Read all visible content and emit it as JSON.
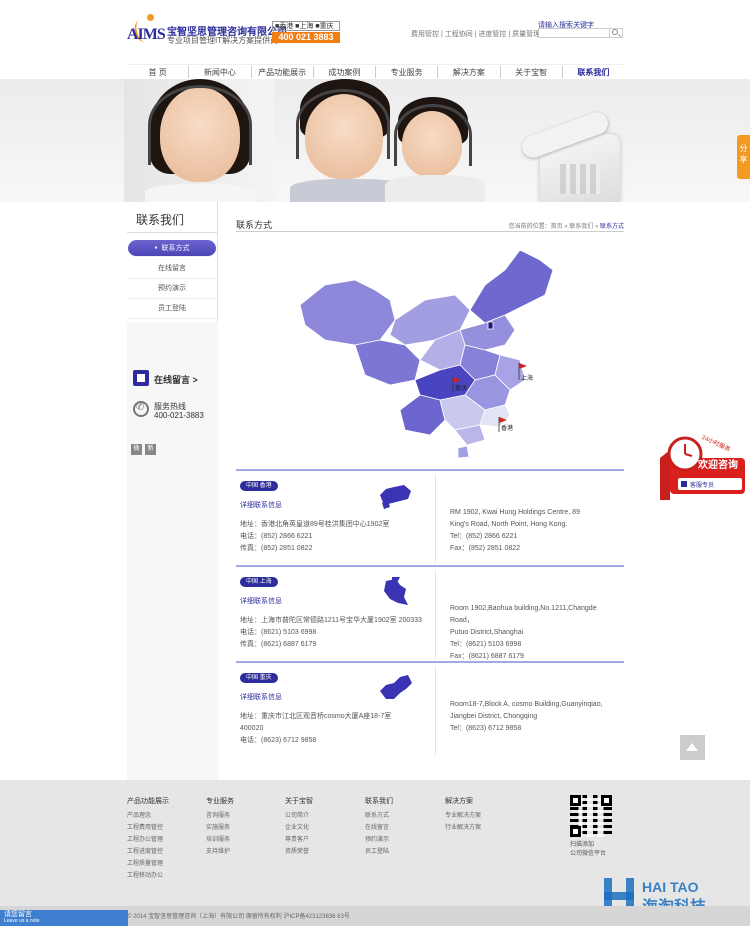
{
  "header": {
    "logo_text": "AIMS",
    "company_name": "宝智坚思管理咨询有限公司",
    "company_sub": "专业项目管理IT解决方案提供商",
    "cities": "■香港 ■上海 ■重庆",
    "hotline": "400 021 3883",
    "toplinks": "费用管控 | 工程协同 | 进度管控 | 质量管理",
    "search_label": "请输入搜索关键字",
    "search_placeholder": ""
  },
  "nav": [
    {
      "label": "首 页"
    },
    {
      "label": "新闻中心"
    },
    {
      "label": "产品功能展示"
    },
    {
      "label": "成功案例"
    },
    {
      "label": "专业服务"
    },
    {
      "label": "解决方案"
    },
    {
      "label": "关于宝智"
    },
    {
      "label": "联系我们"
    }
  ],
  "share_tab": "分享",
  "sidebar": {
    "title": "联系我们",
    "items": [
      {
        "label": "联系方式"
      },
      {
        "label": "在线留言"
      },
      {
        "label": "预约演示"
      },
      {
        "label": "员工登陆"
      }
    ],
    "message_label": "在线留言 >",
    "hotline_label": "服务热线",
    "hotline_number": "400-021-3883",
    "social": [
      "微",
      "新"
    ]
  },
  "main": {
    "title": "联系方式",
    "breadcrumb_prefix": "您当前的位置：首页 » 联系我们 » ",
    "breadcrumb_current": "联系方式"
  },
  "map_labels": {
    "shanghai": "上海",
    "chongqing": "重庆",
    "hongkong": "香港"
  },
  "offices": [
    {
      "tag": "中国 香港",
      "detail": "详细联系信息",
      "cn": [
        "地址：香港北角英皇道89号桂洪集团中心1902室",
        "电话：(852) 2866 6221",
        "传真：(852) 2851 0822"
      ],
      "en": [
        "RM 1902, Kwai Hung Holdings Centre, 89",
        "King's Road, North Point, Hong Kong.",
        "Tel：(852) 2866 6221",
        "Fax：(852) 2851 0822"
      ]
    },
    {
      "tag": "中国 上海",
      "detail": "详细联系信息",
      "cn": [
        "地址：上海市普陀区常德路1211号宝华大厦1902室 200333",
        "电话：(8621) 5103 6998",
        "传真：(8621) 6887 6179"
      ],
      "en": [
        "Room 1902,Baohua building,No.1211,Changde Road，",
        "Putuo District,Shanghai",
        "Tel：(8621) 5103 6998",
        "Fax：(8621) 6887 6179"
      ]
    },
    {
      "tag": "中国 重庆",
      "detail": "详细联系信息",
      "cn": [
        "地址：重庆市江北区观音桥cosmo大厦A座18-7室",
        "400020",
        "电话：(8623) 6712 9858"
      ],
      "en": [
        "Room18-7,Block A, cosmo Building,Guanyinqiao,",
        "Jiangbei District, Chongqing",
        "Tel：(8623) 6712 9858"
      ]
    }
  ],
  "consult": {
    "badge": "24小时服务",
    "title": "欢迎咨询",
    "button": "客服专员"
  },
  "footer": {
    "columns": [
      {
        "title": "产品功能展示",
        "items": [
          "产品理念",
          "工程费用管控",
          "工程办公管理",
          "工程进度管控",
          "工程质量管理",
          "工程移动办公"
        ]
      },
      {
        "title": "专业服务",
        "items": [
          "咨询服务",
          "实施服务",
          "培训服务",
          "支持维护"
        ]
      },
      {
        "title": "关于宝智",
        "items": [
          "公司简介",
          "企业文化",
          "尊贵客户",
          "资质荣誉"
        ]
      },
      {
        "title": "联系我们",
        "items": [
          "联系方式",
          "在线留言",
          "预约演示",
          "员工登陆"
        ]
      },
      {
        "title": "解决方案",
        "items": [
          "专业解决方案",
          "行业解决方案"
        ]
      }
    ],
    "qr_text": [
      "扫描添加",
      "公司微信平台"
    ],
    "copyright": "© 2014 宝智坚思管理咨询（上海）有限公司 保留所有权利 沪ICP备423123836 63号",
    "message_bar": [
      "请您留言",
      "Leave us a note"
    ],
    "watermark_en": "HAI TAO",
    "watermark_cn": "海淘科技"
  },
  "colors": {
    "brand": "#2c2c9c",
    "accent": "#f07e15",
    "map_dark": "#4a44c0",
    "map_light": "#c9c9ee"
  }
}
